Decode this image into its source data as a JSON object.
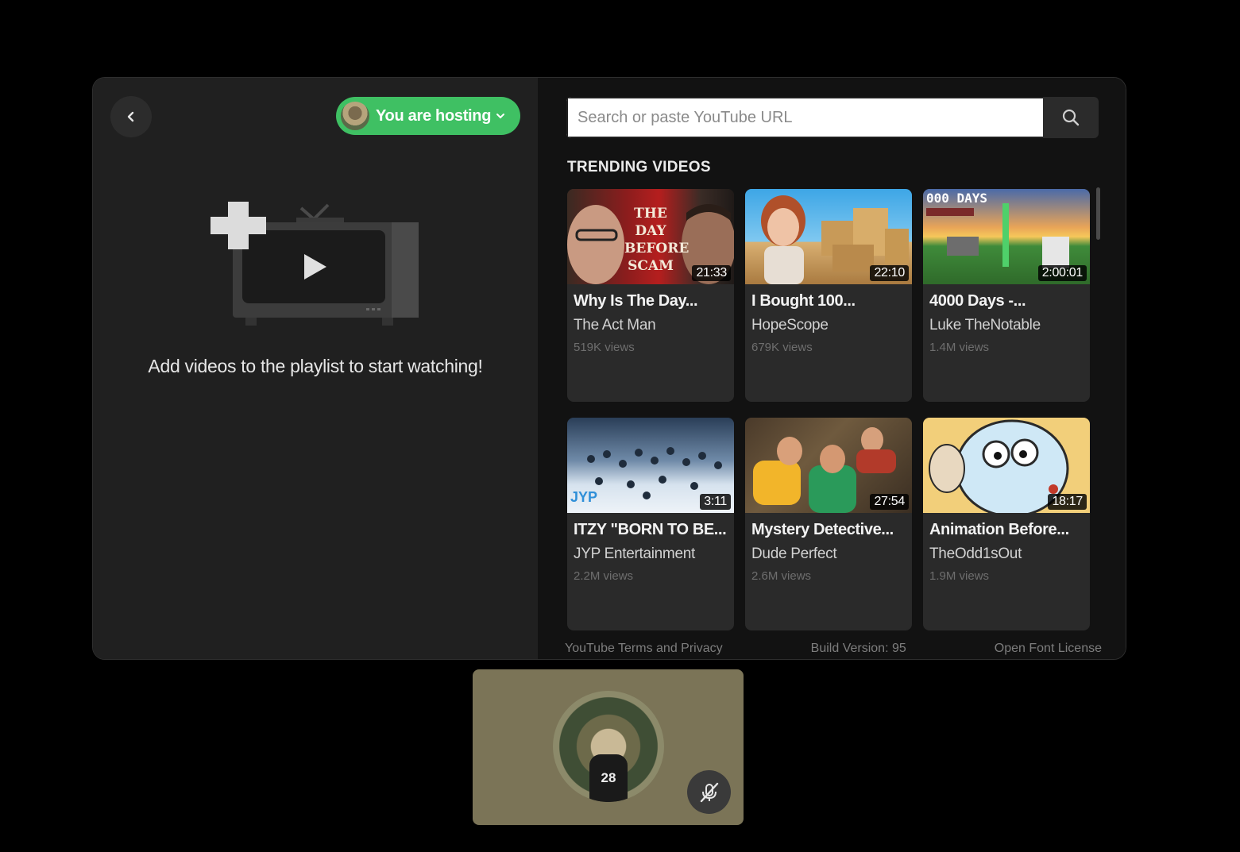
{
  "host": {
    "label": "You are hosting"
  },
  "left": {
    "empty_message": "Add videos to the playlist to start watching!"
  },
  "search": {
    "placeholder": "Search or paste YouTube URL"
  },
  "trending": {
    "title": "TRENDING VIDEOS",
    "videos": [
      {
        "title": "Why Is The Day...",
        "channel": "The Act Man",
        "views": "519K views",
        "duration": "21:33",
        "thumb_text": "THE DAY BEFORE SCAM"
      },
      {
        "title": "I Bought 100...",
        "channel": "HopeScope",
        "views": "679K views",
        "duration": "22:10",
        "thumb_text": ""
      },
      {
        "title": "4000 Days -...",
        "channel": "Luke TheNotable",
        "views": "1.4M views",
        "duration": "2:00:01",
        "thumb_text": "000 DAYS"
      },
      {
        "title": "ITZY \"BORN TO BE...",
        "channel": "JYP Entertainment",
        "views": "2.2M views",
        "duration": "3:11",
        "thumb_text": "JYP"
      },
      {
        "title": "Mystery Detective...",
        "channel": "Dude Perfect",
        "views": "2.6M views",
        "duration": "27:54",
        "thumb_text": ""
      },
      {
        "title": "Animation Before...",
        "channel": "TheOdd1sOut",
        "views": "1.9M views",
        "duration": "18:17",
        "thumb_text": ""
      }
    ]
  },
  "footer": {
    "terms": "YouTube Terms and Privacy",
    "build": "Build Version: 95",
    "license": "Open Font License"
  },
  "participant": {
    "jersey_number": "28"
  },
  "colors": {
    "host_green": "#3fc063",
    "tile_olive": "#7b7457"
  }
}
